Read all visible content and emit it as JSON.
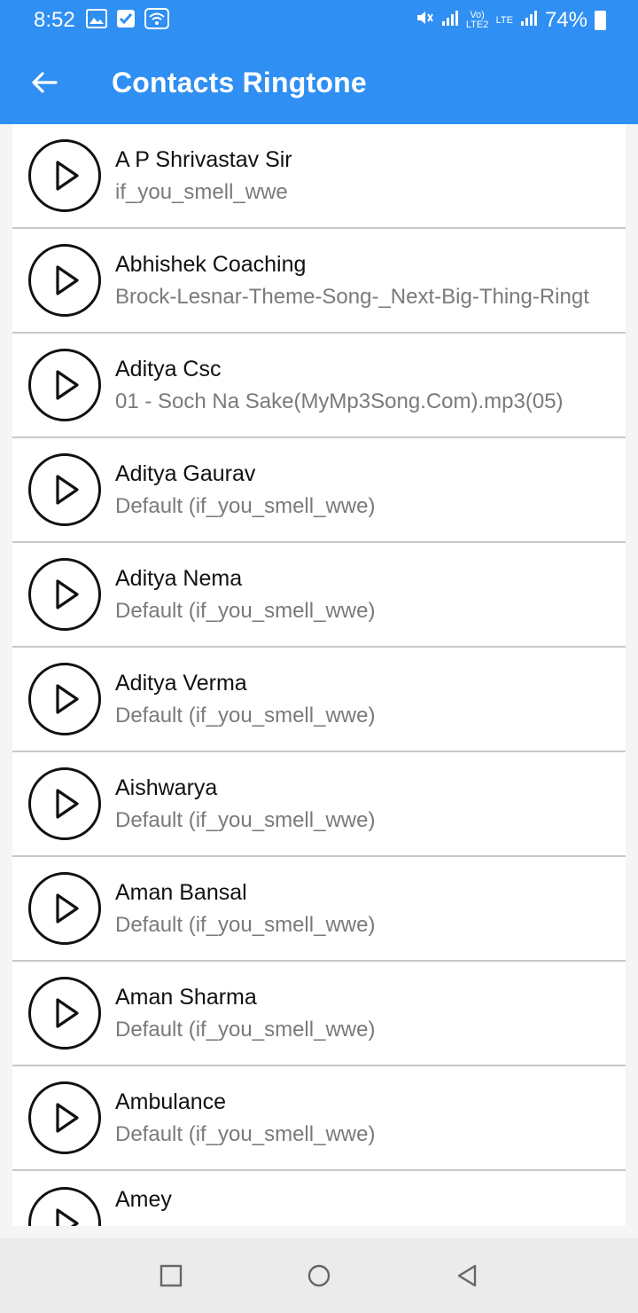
{
  "status_bar": {
    "time": "8:52",
    "battery": "74%",
    "icons": [
      "gallery-icon",
      "check-box-icon",
      "wifi-icon",
      "mute-icon",
      "signal-icon",
      "volte-icon",
      "lte-icon",
      "signal-icon",
      "battery-icon"
    ],
    "volte_label": "Vo) LTE2",
    "lte_label": "LTE"
  },
  "app_bar": {
    "title": "Contacts Ringtone",
    "back_icon": "arrow-back-icon",
    "color": "#2f8ff2"
  },
  "contacts": [
    {
      "name": "A P Shrivastav Sir",
      "ringtone": "if_you_smell_wwe"
    },
    {
      "name": "Abhishek Coaching",
      "ringtone": "Brock-Lesnar-Theme-Song-_Next-Big-Thing-Ringt"
    },
    {
      "name": "Aditya Csc",
      "ringtone": "01 - Soch Na Sake(MyMp3Song.Com).mp3(05)"
    },
    {
      "name": "Aditya Gaurav",
      "ringtone": "Default (if_you_smell_wwe)"
    },
    {
      "name": "Aditya Nema",
      "ringtone": "Default (if_you_smell_wwe)"
    },
    {
      "name": "Aditya Verma",
      "ringtone": "Default (if_you_smell_wwe)"
    },
    {
      "name": "Aishwarya",
      "ringtone": "Default (if_you_smell_wwe)"
    },
    {
      "name": "Aman Bansal",
      "ringtone": "Default (if_you_smell_wwe)"
    },
    {
      "name": "Aman Sharma",
      "ringtone": "Default (if_you_smell_wwe)"
    },
    {
      "name": "Ambulance",
      "ringtone": "Default (if_you_smell_wwe)"
    },
    {
      "name": "Amey",
      "ringtone": ""
    }
  ],
  "nav_bar": {
    "buttons": [
      "recents-square-icon",
      "home-circle-icon",
      "back-triangle-icon"
    ]
  }
}
